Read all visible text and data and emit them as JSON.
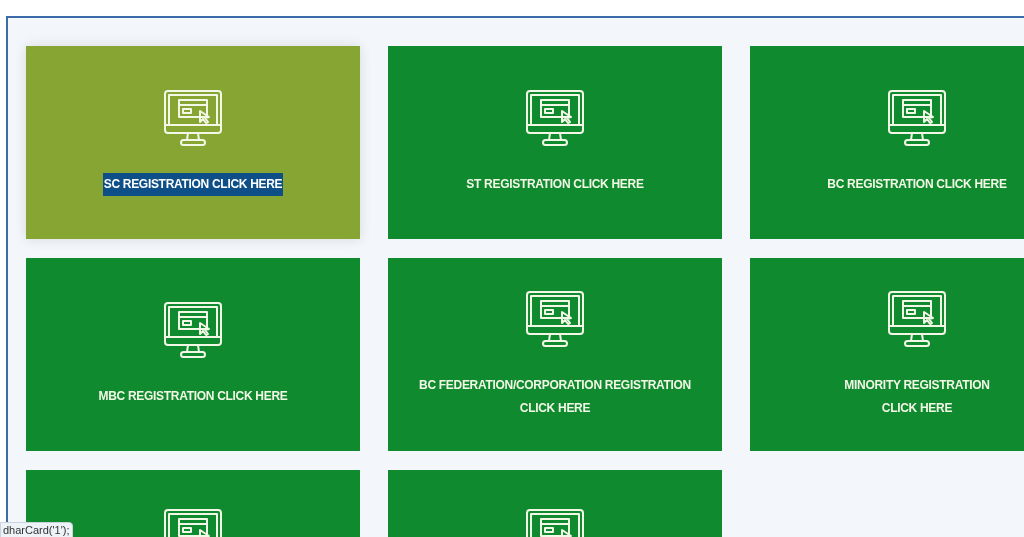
{
  "cards": [
    {
      "lines": [
        "SC REGISTRATION CLICK HERE"
      ],
      "hovered": true,
      "text_selected": true
    },
    {
      "lines": [
        "ST REGISTRATION CLICK HERE"
      ],
      "hovered": false,
      "text_selected": false
    },
    {
      "lines": [
        "BC REGISTRATION CLICK HERE"
      ],
      "hovered": false,
      "text_selected": false
    },
    {
      "lines": [
        "MBC REGISTRATION CLICK HERE"
      ],
      "hovered": false,
      "text_selected": false
    },
    {
      "lines": [
        "BC FEDERATION/CORPORATION REGISTRATION",
        "CLICK HERE"
      ],
      "hovered": false,
      "text_selected": false
    },
    {
      "lines": [
        "MINORITY REGISTRATION",
        "CLICK HERE"
      ],
      "hovered": false,
      "text_selected": false
    },
    {
      "hovered": false
    },
    {
      "hovered": false
    }
  ],
  "status_tooltip": "dharCard('1');"
}
